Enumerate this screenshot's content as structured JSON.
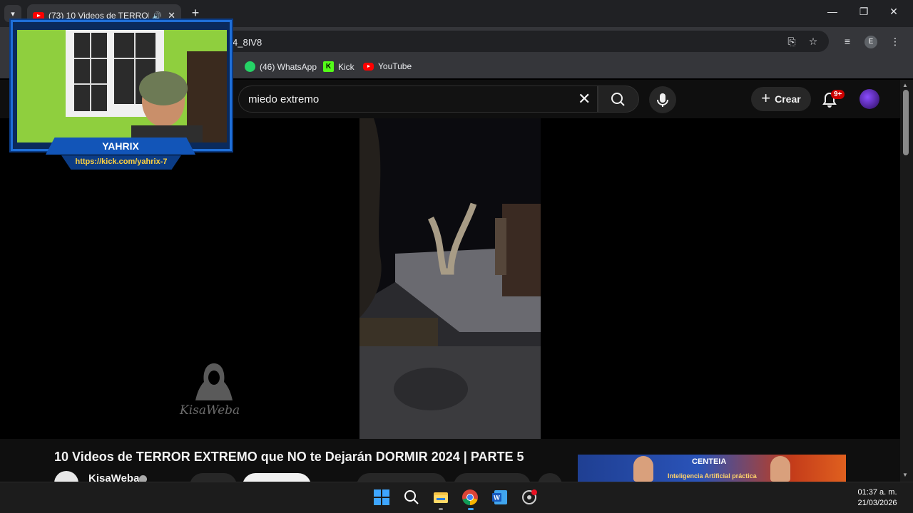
{
  "browser": {
    "tab_title": "(73) 10 Videos de TERROR E",
    "url_fragment": "4_8IV8",
    "profile_initial": "E",
    "bookmarks": [
      {
        "label": "(46) WhatsApp",
        "icon": "whatsapp-icon"
      },
      {
        "label": "Kick",
        "icon": "kick-icon"
      },
      {
        "label": "YouTube",
        "icon": "youtube-icon"
      }
    ]
  },
  "youtube": {
    "search_value": "miedo extremo",
    "create_label": "Crear",
    "notification_badge": "9+",
    "video_title": "10 Videos de TERROR EXTREMO que NO te Dejarán DORMIR 2024 | PARTE 5",
    "channel_name": "KisaWeba",
    "watermark": "KisaWeba"
  },
  "webcam_overlay": {
    "name": "YAHRIX",
    "url": "https://kick.com/yahrix-7"
  },
  "ad": {
    "brand": "CENTEIA",
    "tagline": "Inteligencia Artificial práctica"
  },
  "taskbar": {
    "time": "01:37 a. m.",
    "date": "21/03/2026"
  },
  "colors": {
    "browser_bg": "#202124",
    "youtube_bg": "#0f0f0f",
    "overlay_blue": "#1f6fd8",
    "badge_red": "#cc0000"
  }
}
